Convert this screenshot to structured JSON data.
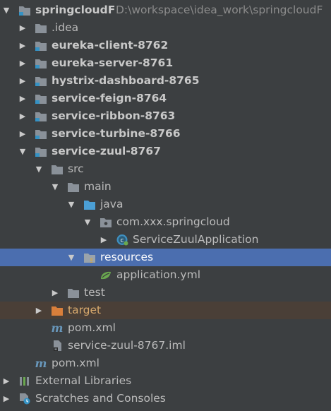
{
  "icons": {
    "folder_color": "#8a9199",
    "module_marker_color": "#3592c4",
    "excluded_folder_color": "#d97f3b",
    "source_folder_color": "#4b9fd5",
    "selection_color": "#4b6eaf",
    "excluded_row_color": "#4a3f37"
  },
  "tree": {
    "root": {
      "label": "springcloudF",
      "path": "D:\\workspace\\idea_work\\springcloudF"
    },
    "modules": [
      {
        "label": ".idea"
      },
      {
        "label": "eureka-client-8762"
      },
      {
        "label": "eureka-server-8761"
      },
      {
        "label": "hystrix-dashboard-8765"
      },
      {
        "label": "service-feign-8764"
      },
      {
        "label": "service-ribbon-8763"
      },
      {
        "label": "service-turbine-8766"
      },
      {
        "label": "service-zuul-8767"
      }
    ],
    "zuul": {
      "src": "src",
      "main": "main",
      "java": "java",
      "package": "com.xxx.springcloud",
      "app_class": "ServiceZuulApplication",
      "resources": "resources",
      "application_yml": "application.yml",
      "test": "test",
      "target": "target",
      "pom": "pom.xml",
      "iml": "service-zuul-8767.iml"
    },
    "root_pom": "pom.xml",
    "external_libraries": "External Libraries",
    "scratches": "Scratches and Consoles"
  }
}
